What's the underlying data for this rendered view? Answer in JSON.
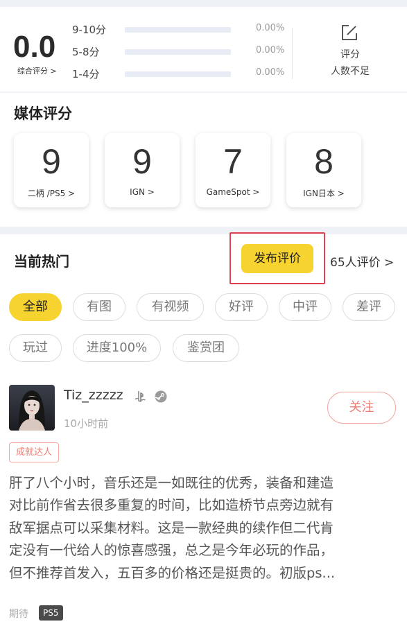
{
  "user_rating": {
    "score": "0.0",
    "score_label": "综合评分 >",
    "rows": [
      {
        "label": "9-10分",
        "percent_text": "0.00%",
        "fill_fraction": 0
      },
      {
        "label": "5-8分",
        "percent_text": "0.00%",
        "fill_fraction": 0
      },
      {
        "label": "1-4分",
        "percent_text": "0.00%",
        "fill_fraction": 0
      }
    ],
    "rate_label": "评分",
    "insufficient_label": "人数不足",
    "icon": "edit-square-icon"
  },
  "media": {
    "title": "媒体评分",
    "cards": [
      {
        "score": "9",
        "source": "二柄 /PS5 >"
      },
      {
        "score": "9",
        "source": "IGN  >"
      },
      {
        "score": "7",
        "source": "GameSpot  >"
      },
      {
        "score": "8",
        "source": "IGN日本  >"
      }
    ]
  },
  "hot": {
    "title": "当前热门",
    "publish_label": "发布评价",
    "review_count_label": "65人评价 >",
    "filters": [
      "全部",
      "有图",
      "有视频",
      "好评",
      "中评",
      "差评",
      "玩过",
      "进度100%",
      "鉴赏团"
    ],
    "active_filter": "全部"
  },
  "post": {
    "username": "Tiz_zzzzz",
    "platform_icons": [
      "playstation-icon",
      "steam-icon"
    ],
    "time": "10小时前",
    "follow_label": "关注",
    "badge": "成就达人",
    "text_lines": [
      "肝了八个小时，音乐还是一如既往的优秀，装备和建造",
      "对比前作省去很多重复的时间，比如造桥节点旁边就有",
      "敌军据点可以采集材料。这是一款经典的续作但二代肯",
      "定没有一代给人的惊喜感强，总之是今年必玩的作品，",
      "但不推荐首发入，五百多的价格还是挺贵的。初版ps..."
    ],
    "tag_label": "期待",
    "platform_tag": "PS5"
  },
  "colors": {
    "accent_yellow": "#f7d330",
    "follow_red": "#ef7d74",
    "highlight_red": "#e04050"
  }
}
